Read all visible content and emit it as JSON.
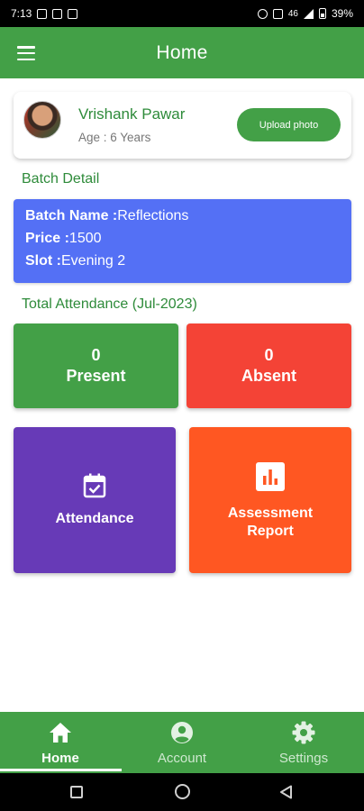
{
  "status_bar": {
    "time": "7:13",
    "network": "46",
    "battery": "39%"
  },
  "app_bar": {
    "title": "Home"
  },
  "profile": {
    "name": "Vrishank Pawar",
    "age": "Age : 6 Years",
    "upload_label": "Upload photo"
  },
  "batch": {
    "section_title": "Batch Detail",
    "name_label": "Batch Name :",
    "name_value": "Reflections",
    "price_label": "Price :",
    "price_value": "1500",
    "slot_label": "Slot :",
    "slot_value": "Evening 2"
  },
  "attendance": {
    "section_title": "Total Attendance (Jul-2023)",
    "present_count": "0",
    "present_label": "Present",
    "absent_count": "0",
    "absent_label": "Absent"
  },
  "actions": {
    "attendance_label": "Attendance",
    "assessment_line1": "Assessment",
    "assessment_line2": "Report"
  },
  "bottom_nav": {
    "items": [
      {
        "label": "Home",
        "icon": "home-icon",
        "active": true
      },
      {
        "label": "Account",
        "icon": "account-icon",
        "active": false
      },
      {
        "label": "Settings",
        "icon": "settings-icon",
        "active": false
      }
    ]
  },
  "colors": {
    "primary_green": "#43a047",
    "batch_blue": "#5470f5",
    "absent_red": "#f44336",
    "attendance_purple": "#673ab7",
    "assessment_orange": "#ff5722"
  }
}
